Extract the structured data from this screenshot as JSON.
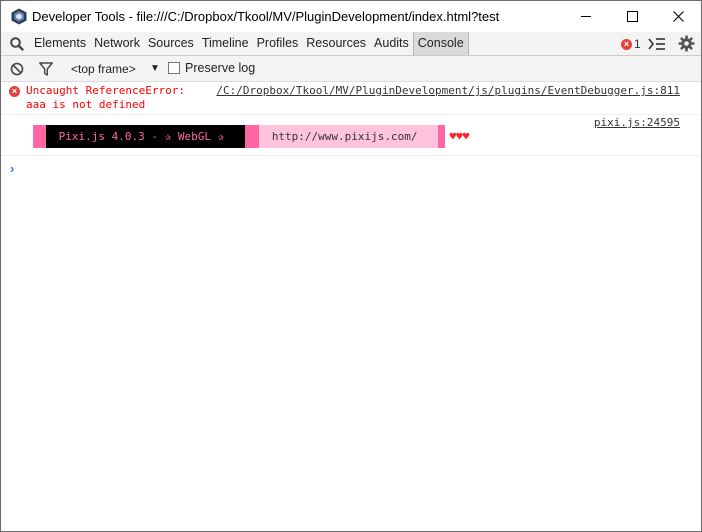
{
  "window": {
    "title": "Developer Tools - file:///C:/Dropbox/Tkool/MV/PluginDevelopment/index.html?test"
  },
  "toolbar": {
    "tabs": [
      {
        "label": "Elements"
      },
      {
        "label": "Network"
      },
      {
        "label": "Sources"
      },
      {
        "label": "Timeline"
      },
      {
        "label": "Profiles"
      },
      {
        "label": "Resources"
      },
      {
        "label": "Audits"
      },
      {
        "label": "Console",
        "selected": true
      }
    ],
    "error_count": "1",
    "error_badge_glyph": "×"
  },
  "filterbar": {
    "frame_select": "<top frame>",
    "frame_arrow": "▼",
    "preserve_log_label": "Preserve log"
  },
  "console": {
    "messages": [
      {
        "level": "error",
        "icon": "×",
        "text": "Uncaught ReferenceError:\naaa is not defined",
        "source": "/C:/Dropbox/Tkool/MV/PluginDevelopment/js/plugins/EventDebugger.js:811"
      },
      {
        "level": "log",
        "source": "pixi.js:24595",
        "banner_text": " Pixi.js 4.0.3 - ✰ WebGL ✰ ",
        "banner_url": "http://www.pixijs.com/",
        "banner_hearts": "♥♥♥"
      }
    ],
    "prompt": "›"
  },
  "colors": {
    "error_red": "#ff0000",
    "pixi_pink": "#ff66a5",
    "pixi_light_pink": "#ffc3dc",
    "prompt_blue": "#2a7ee6"
  }
}
